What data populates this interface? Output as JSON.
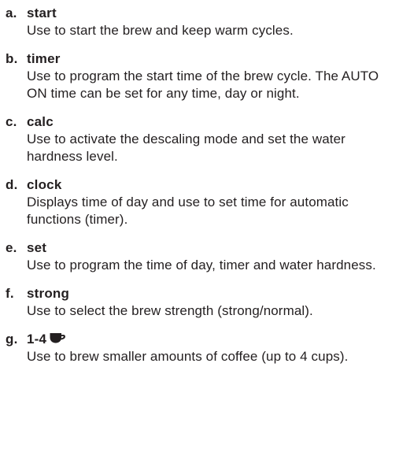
{
  "items": [
    {
      "letter": "a.",
      "title": "start",
      "description": "Use to start the brew and keep warm cycles."
    },
    {
      "letter": "b.",
      "title": "timer",
      "description": "Use to program the start time of the brew cycle. The AUTO ON time can be set for any time, day or night."
    },
    {
      "letter": "c.",
      "title": "calc",
      "description": "Use to activate the descaling mode and set the water hardness level."
    },
    {
      "letter": "d.",
      "title": "clock",
      "description": "Displays time of day and use to set time for automatic functions (timer)."
    },
    {
      "letter": "e.",
      "title": "set",
      "description": "Use to program the time of day, timer and water hardness."
    },
    {
      "letter": "f.",
      "title": "strong",
      "description": "Use to select the brew strength (strong/normal)."
    },
    {
      "letter": "g.",
      "title": "1-4",
      "title_icon": "coffee-cup-icon",
      "description": "Use to brew smaller amounts of coffee (up to 4 cups)."
    }
  ],
  "colors": {
    "text": "#231f20",
    "background": "#ffffff"
  }
}
